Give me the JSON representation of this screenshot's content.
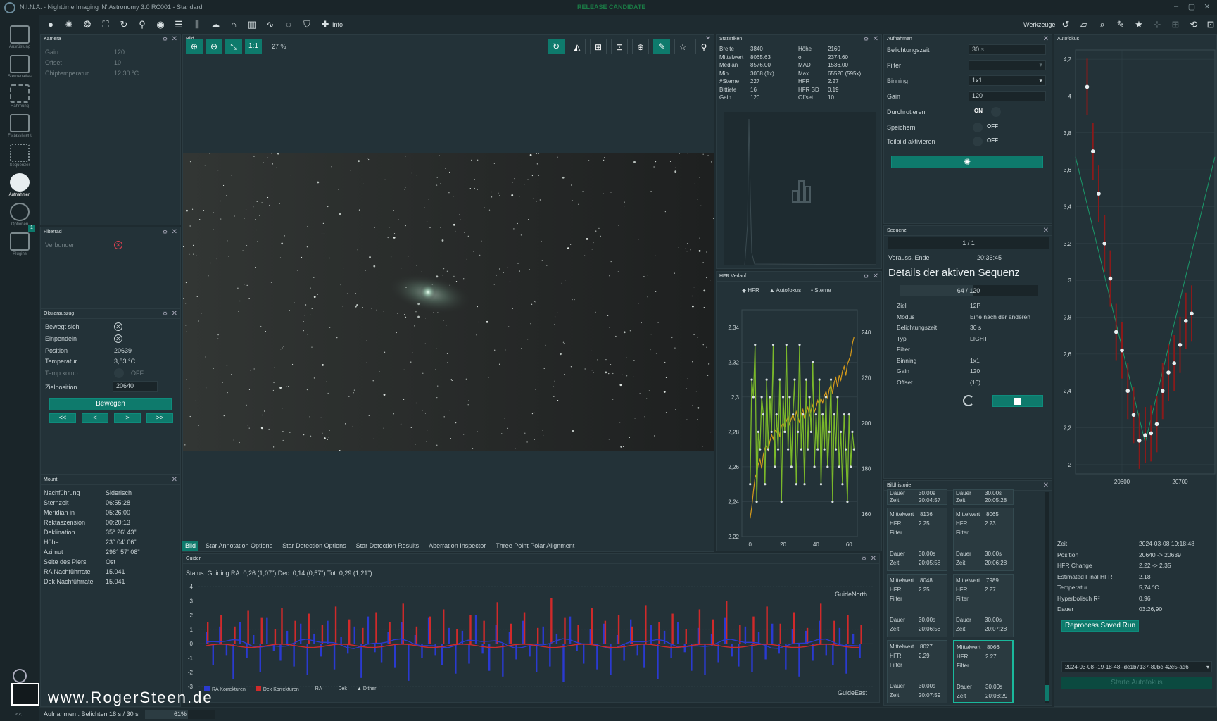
{
  "title": "N.I.N.A. - Nighttime Imaging 'N' Astronomy 3.0 RC001  -  Standard",
  "release_badge": "RELEASE CANDIDATE",
  "toolbar": {
    "info_label": "Info",
    "tools_label": "Werkzeuge"
  },
  "sidebar": [
    {
      "label": "Ausrüstung"
    },
    {
      "label": "Sternenatlas"
    },
    {
      "label": "Rahmung"
    },
    {
      "label": "Flatassistent"
    },
    {
      "label": "Sequenzer"
    },
    {
      "label": "Aufnahmen"
    },
    {
      "label": "Optionen"
    },
    {
      "label": "Plugins",
      "badge": "1"
    }
  ],
  "camera": {
    "title": "Kamera",
    "rows": [
      {
        "label": "Gain",
        "value": "120"
      },
      {
        "label": "Offset",
        "value": "10"
      },
      {
        "label": "Chiptemperatur",
        "value": "12,30 °C"
      }
    ]
  },
  "filterwheel": {
    "title": "Filterrad",
    "connected_label": "Verbunden"
  },
  "focuser": {
    "title": "Okularauszug",
    "moving_label": "Bewegt sich",
    "settle_label": "Einpendeln",
    "position_label": "Position",
    "position_value": "20639",
    "temp_label": "Temperatur",
    "temp_value": "3,83 °C",
    "tempcomp_label": "Temp.komp.",
    "tempcomp_value": "OFF",
    "target_label": "Zielposition",
    "target_value": "20640",
    "move_button": "Bewegen",
    "step_buttons": [
      "<<",
      "<",
      ">",
      ">>"
    ]
  },
  "mount": {
    "title": "Mount",
    "rows": [
      {
        "label": "Nachführung",
        "value": "Siderisch"
      },
      {
        "label": "Sternzeit",
        "value": "06:55:28"
      },
      {
        "label": "Meridian in",
        "value": "05:26:00"
      },
      {
        "label": "Rektaszension",
        "value": "00:20:13"
      },
      {
        "label": "Deklination",
        "value": "35° 26' 43\""
      },
      {
        "label": "Höhe",
        "value": "23° 04' 06\""
      },
      {
        "label": "Azimut",
        "value": "298° 57' 08\""
      },
      {
        "label": "Seite des Piers",
        "value": "Ost"
      },
      {
        "label": "RA Nachführrate",
        "value": "15.041"
      },
      {
        "label": "Dek Nachführrate",
        "value": "15.041"
      }
    ]
  },
  "image": {
    "title": "Bild",
    "zoom": "27 %",
    "one_to_one": "1:1",
    "tabs": [
      "Bild",
      "Star Annotation Options",
      "Star Detection Options",
      "Star Detection Results",
      "Aberration Inspector",
      "Three Point Polar Alignment"
    ]
  },
  "statistics": {
    "title": "Statistiken",
    "left": [
      {
        "label": "Breite",
        "value": "3840"
      },
      {
        "label": "Mittelwert",
        "value": "8065.63"
      },
      {
        "label": "Median",
        "value": "8576.00"
      },
      {
        "label": "Min",
        "value": "3008 (1x)"
      },
      {
        "label": "#Sterne",
        "value": "227"
      },
      {
        "label": "Bittiefe",
        "value": "16"
      },
      {
        "label": "Gain",
        "value": "120"
      }
    ],
    "right": [
      {
        "label": "Höhe",
        "value": "2160"
      },
      {
        "label": "σ",
        "value": "2374.60"
      },
      {
        "label": "MAD",
        "value": "1536.00"
      },
      {
        "label": "Max",
        "value": "65520 (595x)"
      },
      {
        "label": "HFR",
        "value": "2.27"
      },
      {
        "label": "HFR SD",
        "value": "0.19"
      },
      {
        "label": "Offset",
        "value": "10"
      }
    ]
  },
  "hfr": {
    "title": "HFR Verlauf",
    "legend": [
      "HFR",
      "Autofokus",
      "Sterne"
    ],
    "colors": {
      "hfr": "#7ab82a",
      "stars": "#d69a1a",
      "points": "#d8e0e2"
    }
  },
  "capture": {
    "title": "Aufnahmen",
    "rows": [
      {
        "label": "Belichtungszeit",
        "value": "30",
        "unit": "s"
      },
      {
        "label": "Filter",
        "value": ""
      },
      {
        "label": "Binning",
        "value": "1x1"
      },
      {
        "label": "Gain",
        "value": "120"
      },
      {
        "label": "Durchrotieren",
        "value": "ON"
      },
      {
        "label": "Speichern",
        "value": "OFF"
      },
      {
        "label": "Teilbild aktivieren",
        "value": "OFF"
      }
    ]
  },
  "sequence": {
    "title": "Sequenz",
    "progress": "1 / 1",
    "end_label": "Vorauss. Ende",
    "end_value": "20:36:45",
    "details_title": "Details der aktiven Sequenz",
    "count": "64 / 120",
    "count_fraction": 0.533,
    "rows": [
      {
        "label": "Ziel",
        "value": "12P"
      },
      {
        "label": "Modus",
        "value": "Eine nach der anderen"
      },
      {
        "label": "Belichtungszeit",
        "value": "30 s"
      },
      {
        "label": "Typ",
        "value": "LIGHT"
      },
      {
        "label": "Filter",
        "value": ""
      },
      {
        "label": "Binning",
        "value": "1x1"
      },
      {
        "label": "Gain",
        "value": "120"
      },
      {
        "label": "Offset",
        "value": "(10)"
      }
    ]
  },
  "history": {
    "title": "Bildhistorie",
    "top": [
      {
        "dauer": "30.00s",
        "zeit": "20:04:57"
      },
      {
        "dauer": "30.00s",
        "zeit": "20:05:28"
      }
    ],
    "items": [
      {
        "mittel": "8136",
        "hfr": "2.25",
        "dauer": "30.00s",
        "zeit": "20:05:58"
      },
      {
        "mittel": "8065",
        "hfr": "2.23",
        "dauer": "30.00s",
        "zeit": "20:06:28"
      },
      {
        "mittel": "8048",
        "hfr": "2.25",
        "dauer": "30.00s",
        "zeit": "20:06:58"
      },
      {
        "mittel": "7989",
        "hfr": "2.27",
        "dauer": "30.00s",
        "zeit": "20:07:28"
      },
      {
        "mittel": "8027",
        "hfr": "2.29",
        "dauer": "30.00s",
        "zeit": "20:07:59"
      },
      {
        "mittel": "8066",
        "hfr": "2.27",
        "dauer": "30.00s",
        "zeit": "20:08:29"
      }
    ],
    "labels": {
      "mittel": "Mittelwert",
      "hfr": "HFR",
      "filter": "Filter",
      "dauer": "Dauer",
      "zeit": "Zeit"
    }
  },
  "autofocus": {
    "title": "Autofokus",
    "rows": [
      {
        "label": "Zeit",
        "value": "2024-03-08 19:18:48"
      },
      {
        "label": "Position",
        "value": "20640 -> 20639"
      },
      {
        "label": "HFR Change",
        "value": "2.22 -> 2.35"
      },
      {
        "label": "Estimated Final HFR",
        "value": "2.18"
      },
      {
        "label": "Temperatur",
        "value": "5,74 °C"
      },
      {
        "label": "Hyperbolisch R²",
        "value": "0.96"
      },
      {
        "label": "Dauer",
        "value": "03:26,90"
      }
    ],
    "reprocess_button": "Reprocess Saved Run",
    "run_select": "2024-03-08--19-18-48--de1b7137-80bc-42e5-ad6",
    "start_button": "Starte Autofokus"
  },
  "guider": {
    "title": "Guider",
    "status": "Status: Guiding  RA: 0,26 (1,07\")  Dec: 0,14 (0,57\")  Tot: 0,29 (1,21\")",
    "north": "GuideNorth",
    "east": "GuideEast",
    "legend": [
      "RA Korrekturen",
      "Dek Korrekturen",
      "RA",
      "Dek",
      "Dither"
    ],
    "colors": {
      "ra": "#2a3ad0",
      "dec": "#d02a2a"
    }
  },
  "statusbar": {
    "text": "Aufnahmen :   Belichten 18 s / 30 s",
    "percent": "61%",
    "progress": 0.61
  },
  "watermark": "www.RogerSteen.de",
  "chart_data": [
    {
      "type": "line",
      "title": "HFR Verlauf",
      "x_ticks": [
        "0",
        "20",
        "40",
        "60"
      ],
      "y_left_ticks": [
        "2,22",
        "2,24",
        "2,26",
        "2,28",
        "2,3",
        "2,32",
        "2,34"
      ],
      "y_right_ticks": [
        "160",
        "180",
        "200",
        "220",
        "240"
      ],
      "ylim_left": [
        2.22,
        2.35
      ],
      "ylim_right": [
        150,
        250
      ],
      "xlim": [
        -5,
        65
      ],
      "series": [
        {
          "name": "HFR",
          "axis": "left",
          "values": [
            2.25,
            2.31,
            2.3,
            2.33,
            2.24,
            2.28,
            2.27,
            2.3,
            2.29,
            2.25,
            2.31,
            2.27,
            2.3,
            2.28,
            2.33,
            2.26,
            2.29,
            2.27,
            2.31,
            2.24,
            2.3,
            2.28,
            2.33,
            2.27,
            2.3,
            2.26,
            2.29,
            2.31,
            2.25,
            2.28,
            2.33,
            2.27,
            2.29,
            2.25,
            2.31,
            2.27,
            2.3,
            2.28,
            2.32,
            2.26,
            2.29,
            2.27,
            2.31,
            2.25,
            2.29,
            2.27,
            2.3,
            2.26,
            2.28,
            2.31,
            2.24,
            2.29,
            2.27,
            2.3,
            2.26,
            2.28,
            2.25,
            2.29,
            2.27,
            2.24,
            2.29,
            2.26,
            2.28,
            2.27
          ]
        },
        {
          "name": "Sterne",
          "axis": "right",
          "values": [
            158,
            163,
            170,
            176,
            178,
            182,
            184,
            180,
            186,
            189,
            190,
            188,
            192,
            195,
            193,
            197,
            196,
            198,
            194,
            199,
            200,
            198,
            201,
            203,
            199,
            202,
            204,
            201,
            205,
            203,
            200,
            204,
            206,
            202,
            205,
            207,
            203,
            206,
            208,
            205,
            207,
            210,
            208,
            211,
            209,
            212,
            214,
            211,
            215,
            217,
            213,
            218,
            220,
            216,
            221,
            219,
            223,
            225,
            221,
            226,
            228,
            230,
            235,
            238
          ]
        }
      ]
    },
    {
      "type": "scatter",
      "title": "Autofokus",
      "x_ticks": [
        "20600",
        "20700"
      ],
      "y_ticks": [
        "2",
        "2,2",
        "2,4",
        "2,6",
        "2,8",
        "3",
        "3,2",
        "3,4",
        "3,6",
        "3,8",
        "4",
        "4,2"
      ],
      "xlim": [
        20520,
        20760
      ],
      "ylim": [
        1.95,
        4.25
      ],
      "points": [
        [
          20540,
          4.05
        ],
        [
          20550,
          3.7
        ],
        [
          20560,
          3.47
        ],
        [
          20570,
          3.2
        ],
        [
          20580,
          3.01
        ],
        [
          20590,
          2.72
        ],
        [
          20600,
          2.62
        ],
        [
          20610,
          2.4
        ],
        [
          20620,
          2.27
        ],
        [
          20630,
          2.13
        ],
        [
          20640,
          2.16
        ],
        [
          20650,
          2.17
        ],
        [
          20660,
          2.22
        ],
        [
          20670,
          2.4
        ],
        [
          20680,
          2.5
        ],
        [
          20690,
          2.55
        ],
        [
          20700,
          2.65
        ],
        [
          20710,
          2.78
        ],
        [
          20720,
          2.82
        ]
      ]
    },
    {
      "type": "bar",
      "title": "Guider",
      "y_ticks": [
        "4",
        "3",
        "2",
        "1",
        "0",
        "-1",
        "-2",
        "-3"
      ],
      "ylim": [
        -3,
        4
      ],
      "series": [
        {
          "name": "RA Korrekturen",
          "values": [
            0.8,
            -1.5,
            1.2,
            -0.8,
            -2.5,
            1.5,
            -1.0,
            0.6,
            -2.0,
            1.8,
            -0.5,
            -1.2,
            0.9,
            -1.6,
            1.4,
            -2.2,
            0.7,
            -0.9,
            1.6,
            -1.8,
            0.5,
            -0.7,
            1.2,
            -2.4,
            1.9,
            -0.6,
            -1.3,
            0.8,
            -1.7,
            1.5,
            -2.6,
            0.6,
            -1.0,
            1.8,
            -0.8,
            -1.5,
            1.1,
            -2.1,
            0.9,
            -1.4,
            2.0,
            -0.7,
            -1.9,
            1.3,
            -2.3,
            0.8,
            -1.1,
            1.6,
            -0.9,
            -2.0,
            1.2,
            -1.6,
            0.7,
            -2.7,
            1.9,
            -0.5,
            -1.4,
            1.0,
            -1.8,
            1.4,
            -2.2,
            0.6,
            -1.2,
            1.7,
            -0.8,
            -1.7,
            1.3,
            -2.5,
            0.9,
            -1.0,
            1.5,
            -0.6,
            -1.9,
            1.1,
            -2.2,
            0.7,
            -1.3,
            1.8,
            -0.9,
            -1.6,
            1.2,
            -2.0,
            0.8,
            -1.1,
            1.4,
            -0.7,
            -1.8,
            1.0,
            -2.3,
            0.9,
            -1.2,
            1.6,
            -0.8,
            -1.5,
            1.1,
            -2.1,
            0.7,
            -1.0
          ]
        },
        {
          "name": "Dek Korrekturen",
          "values": [
            1.5,
            0.0,
            2.0,
            0.0,
            1.2,
            0.0,
            2.3,
            0.0,
            1.8,
            0.0,
            1.0,
            2.5,
            0.0,
            1.6,
            0.0,
            2.1,
            0.0,
            1.3,
            0.0,
            2.6,
            0.0,
            1.7,
            0.0,
            1.1,
            0.0,
            2.2,
            0.0,
            1.5,
            0.0,
            2.8,
            0.0,
            1.2,
            0.0,
            1.9,
            0.0,
            2.4,
            0.0,
            1.0,
            0.0,
            2.0,
            0.0,
            1.6,
            0.0,
            2.9,
            0.0,
            1.4,
            0.0,
            2.2,
            0.0,
            1.1,
            0.0,
            3.2,
            0.0,
            1.8,
            0.0,
            1.3,
            0.0,
            2.5,
            0.0,
            1.6,
            0.0,
            2.0,
            0.0,
            1.2,
            0.0,
            2.7,
            0.0,
            1.5,
            0.0,
            2.1,
            0.0,
            1.0,
            0.0,
            2.4,
            0.0,
            1.7,
            0.0,
            3.0,
            0.0,
            1.3,
            0.0,
            1.9,
            0.0,
            2.6,
            0.0,
            1.4,
            0.0,
            2.2,
            0.0,
            1.1,
            0.0,
            2.8,
            0.0,
            1.6,
            0.0,
            2.0,
            0.0,
            1.3
          ]
        }
      ]
    }
  ]
}
